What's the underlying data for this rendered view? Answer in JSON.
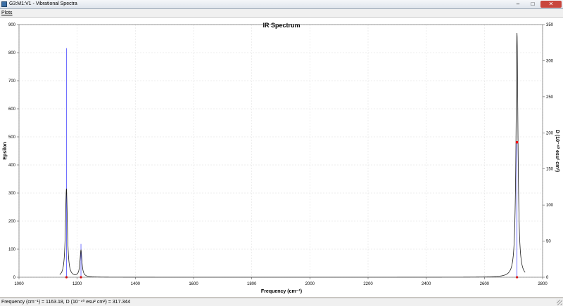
{
  "window": {
    "title": "G3:M1:V1 - Vibrational Spectra",
    "minimize_glyph": "–",
    "maximize_glyph": "□",
    "close_glyph": "✕"
  },
  "menu": {
    "items": [
      "Plots"
    ]
  },
  "chart": {
    "title": "IR Spectrum",
    "xlabel": "Frequency (cm⁻¹)",
    "ylabel_left": "Epsilon",
    "ylabel_right": "D (10⁻⁴⁰ esu² cm²)"
  },
  "status": {
    "text": "Frequency (cm⁻¹) = 1163.18, D (10⁻⁴⁰ esu² cm²) = 317.344"
  },
  "colors": {
    "spectrum_line": "#1c1c1c",
    "stick_line": "#5050ff",
    "marker": "#ff0000",
    "grid": "#dcdcdc"
  },
  "chart_data": {
    "type": "line",
    "title": "IR Spectrum",
    "xlabel": "Frequency (cm⁻¹)",
    "ylabel": "Epsilon",
    "y2label": "D (10⁻⁴⁰ esu² cm²)",
    "xlim": [
      1000,
      2800
    ],
    "ylim": [
      0,
      900
    ],
    "y2lim": [
      0,
      350
    ],
    "x_ticks": [
      1000,
      1200,
      1400,
      1600,
      1800,
      2000,
      2200,
      2400,
      2600,
      2800
    ],
    "y_ticks": [
      0,
      100,
      200,
      300,
      400,
      500,
      600,
      700,
      800,
      900
    ],
    "y2_ticks": [
      0,
      50,
      100,
      150,
      200,
      250,
      300,
      350
    ],
    "grid": true,
    "series": [
      {
        "type": "line",
        "peaks": [
          {
            "x": 1163,
            "y": 315
          },
          {
            "x": 1213,
            "y": 95
          },
          {
            "x": 2712,
            "y": 870
          }
        ]
      },
      {
        "type": "stick",
        "axis": "right",
        "points": [
          {
            "x": 1163.18,
            "y": 317.344
          },
          {
            "x": 1213,
            "y": 46
          },
          {
            "x": 2712,
            "y": 187
          }
        ]
      }
    ]
  }
}
